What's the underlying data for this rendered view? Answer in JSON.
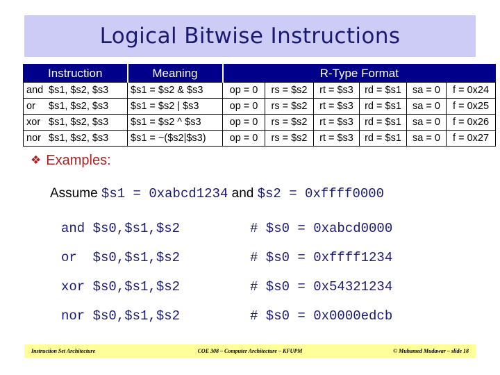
{
  "slide": {
    "title": "Logical Bitwise Instructions"
  },
  "table": {
    "headers": {
      "instruction": "Instruction",
      "meaning": "Meaning",
      "rtype": "R-Type Format"
    },
    "rows": [
      {
        "mnemonic": "and",
        "operands": "$s1, $s2, $s3",
        "meaning": "$s1 = $s2 & $s3",
        "op": "op = 0",
        "rs": "rs = $s2",
        "rt": "rt = $s3",
        "rd": "rd = $s1",
        "sa": "sa = 0",
        "f": "f = 0x24"
      },
      {
        "mnemonic": "or",
        "operands": "$s1, $s2, $s3",
        "meaning": "$s1 = $s2 | $s3",
        "op": "op = 0",
        "rs": "rs = $s2",
        "rt": "rt = $s3",
        "rd": "rd = $s1",
        "sa": "sa = 0",
        "f": "f = 0x25"
      },
      {
        "mnemonic": "xor",
        "operands": "$s1, $s2, $s3",
        "meaning": "$s1 = $s2 ^ $s3",
        "op": "op = 0",
        "rs": "rs = $s2",
        "rt": "rt = $s3",
        "rd": "rd = $s1",
        "sa": "sa = 0",
        "f": "f = 0x26"
      },
      {
        "mnemonic": "nor",
        "operands": "$s1, $s2, $s3",
        "meaning": "$s1 = ~($s2|$s3)",
        "op": "op = 0",
        "rs": "rs = $s2",
        "rt": "rt = $s3",
        "rd": "rd = $s1",
        "sa": "sa = 0",
        "f": "f = 0x27"
      }
    ]
  },
  "examples": {
    "bullet": "❖",
    "label": "Examples:",
    "assume": {
      "prefix": "Assume ",
      "reg1": "$s1 = 0xabcd1234",
      "conjunction": " and ",
      "reg2": "$s2 = 0xffff0000"
    },
    "lines": [
      {
        "instruction": "and $s0,$s1,$s2",
        "comment": "# $s0 = 0xabcd0000"
      },
      {
        "instruction": "or  $s0,$s1,$s2",
        "comment": "# $s0 = 0xffff1234"
      },
      {
        "instruction": "xor $s0,$s1,$s2",
        "comment": "# $s0 = 0x54321234"
      },
      {
        "instruction": "nor $s0,$s1,$s2",
        "comment": "# $s0 = 0x0000edcb"
      }
    ]
  },
  "footer": {
    "left": "Instruction Set Architecture",
    "center": "COE 308 – Computer Architecture – KFUPM",
    "right": "© Muhamed Mudawar – slide 18"
  },
  "colors": {
    "title_banner_bg": "#ccccf7",
    "title_text": "#191970",
    "table_header_bg": "#00008b",
    "accent_red": "#b02020",
    "code_navy": "#191970",
    "footer_bg": "#ffff99"
  }
}
